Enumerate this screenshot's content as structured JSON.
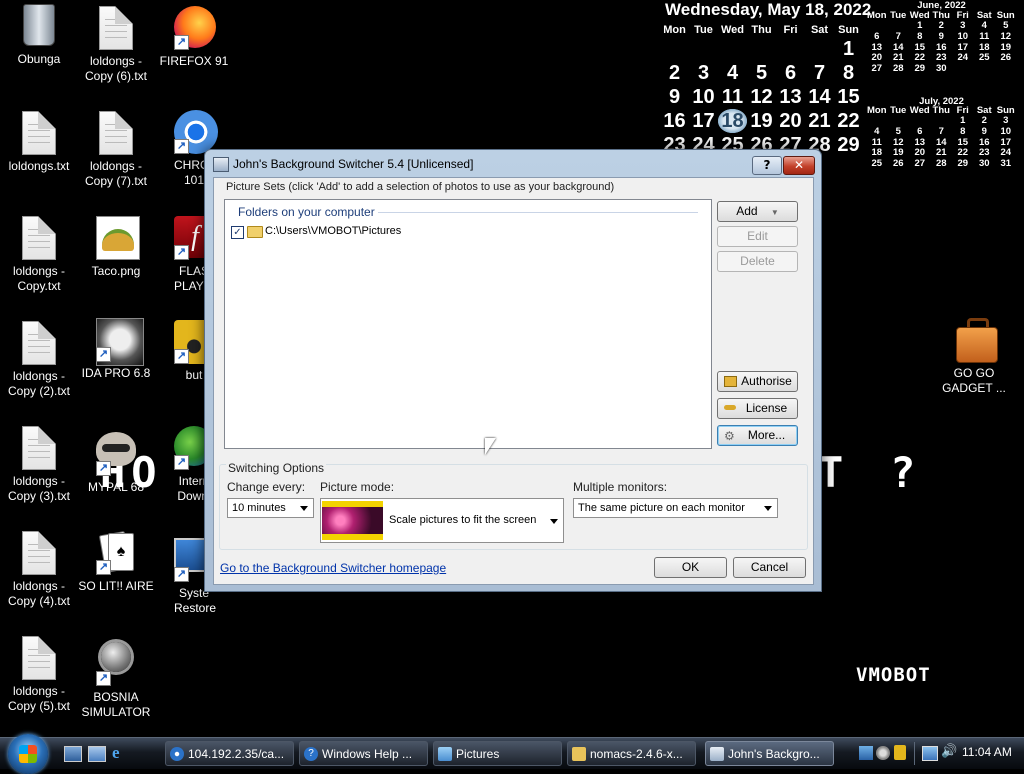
{
  "desktop": {
    "icons": [
      {
        "label": "Obunga"
      },
      {
        "label": "loldongs.txt"
      },
      {
        "label": "loldongs - Copy.txt"
      },
      {
        "label": "loldongs - Copy (2).txt"
      },
      {
        "label": "loldongs - Copy (3).txt"
      },
      {
        "label": "loldongs - Copy (4).txt"
      },
      {
        "label": "loldongs - Copy (5).txt"
      },
      {
        "label": "loldongs - Copy (6).txt"
      },
      {
        "label": "loldongs - Copy (7).txt"
      },
      {
        "label": "Taco.png"
      },
      {
        "label": "IDA PRO 6.8"
      },
      {
        "label": "MYPAL 68"
      },
      {
        "label": "SO LIT!! AIRE"
      },
      {
        "label": "BOSNIA SIMULATOR"
      },
      {
        "label": "FIREFOX 91"
      },
      {
        "label": "CHROM 101"
      },
      {
        "label": "FLAS PLAYER"
      },
      {
        "label": "but"
      },
      {
        "label": "Intern Downl"
      },
      {
        "label": "Syste Restore"
      },
      {
        "label": "GO GO GADGET ..."
      }
    ],
    "overlay_text": {
      "left": "HO",
      "mid": "T",
      "q": "?",
      "brand": "VMOBOT"
    }
  },
  "calendar": {
    "date_title": "Wednesday, May 18, 2022",
    "dows": [
      "Mon",
      "Tue",
      "Wed",
      "Thu",
      "Fri",
      "Sat",
      "Sun"
    ],
    "big_days": [
      "",
      "",
      "",
      "",
      "",
      "",
      "1",
      "2",
      "3",
      "4",
      "5",
      "6",
      "7",
      "8",
      "9",
      "10",
      "11",
      "12",
      "13",
      "14",
      "15",
      "16",
      "17",
      "18",
      "19",
      "20",
      "21",
      "22",
      "23",
      "24",
      "25",
      "26",
      "27",
      "28",
      "29"
    ],
    "june": {
      "title": "June, 2022",
      "days": [
        "",
        "",
        "1",
        "2",
        "3",
        "4",
        "5",
        "6",
        "7",
        "8",
        "9",
        "10",
        "11",
        "12",
        "13",
        "14",
        "15",
        "16",
        "17",
        "18",
        "19",
        "20",
        "21",
        "22",
        "23",
        "24",
        "25",
        "26",
        "27",
        "28",
        "29",
        "30"
      ]
    },
    "july": {
      "title": "July, 2022",
      "days": [
        "",
        "",
        "",
        "",
        "1",
        "2",
        "3",
        "4",
        "5",
        "6",
        "7",
        "8",
        "9",
        "10",
        "11",
        "12",
        "13",
        "14",
        "15",
        "16",
        "17",
        "18",
        "19",
        "20",
        "21",
        "22",
        "23",
        "24",
        "25",
        "26",
        "27",
        "28",
        "29",
        "30",
        "31"
      ]
    }
  },
  "dialog": {
    "title": "John's Background Switcher 5.4 [Unlicensed]",
    "help_label": "?",
    "picture_sets_label": "Picture Sets (click 'Add' to add a selection of photos to use as your background)",
    "folders_header": "Folders on your computer",
    "folder_path": "C:\\Users\\VMOBOT\\Pictures",
    "buttons": {
      "add": "Add",
      "edit": "Edit",
      "delete": "Delete",
      "authorise": "Authorise",
      "license": "License",
      "more": "More...",
      "ok": "OK",
      "cancel": "Cancel"
    },
    "switching_label": "Switching Options",
    "change_every_label": "Change every:",
    "change_every_value": "10 minutes",
    "picture_mode_label": "Picture mode:",
    "picture_mode_value": "Scale pictures to fit the screen",
    "monitors_label": "Multiple monitors:",
    "monitors_value": "The same picture on each monitor",
    "homepage_link": "Go to the Background Switcher homepage"
  },
  "taskbar": {
    "items": [
      {
        "label": "104.192.2.35/ca..."
      },
      {
        "label": "Windows Help ..."
      },
      {
        "label": "Pictures"
      },
      {
        "label": "nomacs-2.4.6-x..."
      },
      {
        "label": "John's Backgro..."
      }
    ],
    "clock": "11:04 AM"
  }
}
